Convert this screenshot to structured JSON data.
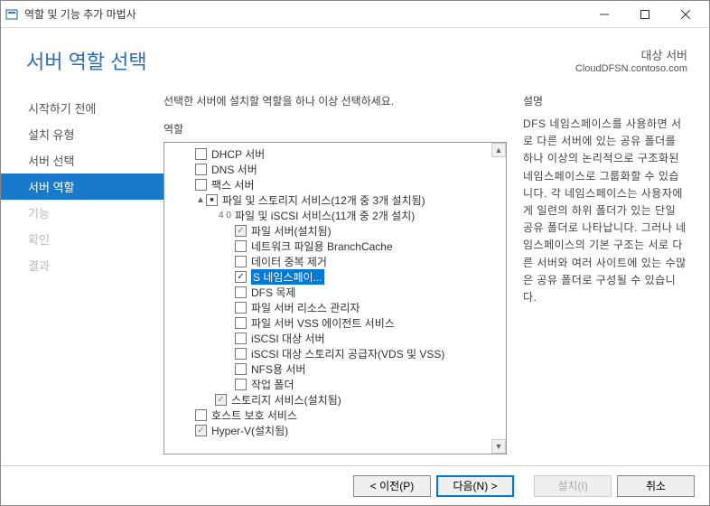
{
  "window": {
    "title": "역할 및 기능 추가 마법사"
  },
  "header": {
    "page_title": "서버 역할 선택",
    "target_label": "대상 서버",
    "target_server": "CloudDFSN.contoso.com"
  },
  "sidebar": {
    "items": [
      {
        "label": "시작하기 전에",
        "state": "completed"
      },
      {
        "label": "설치 유형",
        "state": "completed"
      },
      {
        "label": "서버 선택",
        "state": "completed"
      },
      {
        "label": "서버 역할",
        "state": "active"
      },
      {
        "label": "기능",
        "state": "pending"
      },
      {
        "label": "확인",
        "state": "pending"
      },
      {
        "label": "결과",
        "state": "pending"
      }
    ]
  },
  "center": {
    "instruction": "선택한 서버에 설치할 역할을 하나 이상 선택하세요.",
    "roles_label": "역할",
    "tree": [
      {
        "indent": 1,
        "check": "empty",
        "label": "DHCP 서버"
      },
      {
        "indent": 1,
        "check": "empty",
        "label": "DNS 서버"
      },
      {
        "indent": 1,
        "check": "empty",
        "label": "팩스 서버"
      },
      {
        "indent": 1,
        "toggle": "▲",
        "check": "partial",
        "label": "파일 및 스토리지 서비스(12개 중 3개 설치됨)"
      },
      {
        "indent": 2,
        "toggle": "4 0",
        "label": "파일 및 iSCSI 서비스(11개 중 2개 설치)"
      },
      {
        "indent": 3,
        "check": "checked-gray",
        "label": "파일 서버(설치됨)"
      },
      {
        "indent": 3,
        "check": "empty",
        "label": "네트워크 파일용 BranchCache"
      },
      {
        "indent": 3,
        "check": "empty",
        "label": "데이터 중복 제거"
      },
      {
        "indent": 3,
        "check": "checked",
        "label": "S 네임스페이...",
        "selected": true
      },
      {
        "indent": 3,
        "check": "empty",
        "label": "DFS 목제"
      },
      {
        "indent": 3,
        "check": "empty",
        "label": "파일 서버 리소스 관리자"
      },
      {
        "indent": 3,
        "check": "empty",
        "label": "파일 서버 VSS 에이전트 서비스"
      },
      {
        "indent": 3,
        "check": "empty",
        "label": "iSCSI 대상 서버"
      },
      {
        "indent": 3,
        "check": "empty",
        "label": "iSCSI 대상 스토리지 공급자(VDS 및 VSS)"
      },
      {
        "indent": 3,
        "check": "empty",
        "label": "NFS용 서버"
      },
      {
        "indent": 3,
        "check": "empty",
        "label": "작업 폴더"
      },
      {
        "indent": 2,
        "check": "checked-gray",
        "label": "스토리지 서비스(설치됨)"
      },
      {
        "indent": 1,
        "check": "empty",
        "label": "호스트 보호 서비스"
      },
      {
        "indent": 1,
        "check": "checked-gray",
        "label": "Hyper-V(설치됨)"
      }
    ]
  },
  "description": {
    "title": "설명",
    "text": "DFS 네임스페이스를 사용하면 서로 다른 서버에 있는 공유 폴더를 하나 이상의 논리적으로 구조화된 네임스페이스로 그룹화할 수 있습니다. 각 네임스페이스는 사용자에게 일련의 하위 폴더가 있는 단일 공유 폴더로 나타납니다. 그러나 네임스페이스의 기본 구조는 서로 다른 서버와 여러 사이트에 있는 수많은 공유 폴더로 구성될 수 있습니다."
  },
  "footer": {
    "previous": "< 이전(P)",
    "next": "다음(N) >",
    "install": "설치(I)",
    "cancel": "취소"
  }
}
